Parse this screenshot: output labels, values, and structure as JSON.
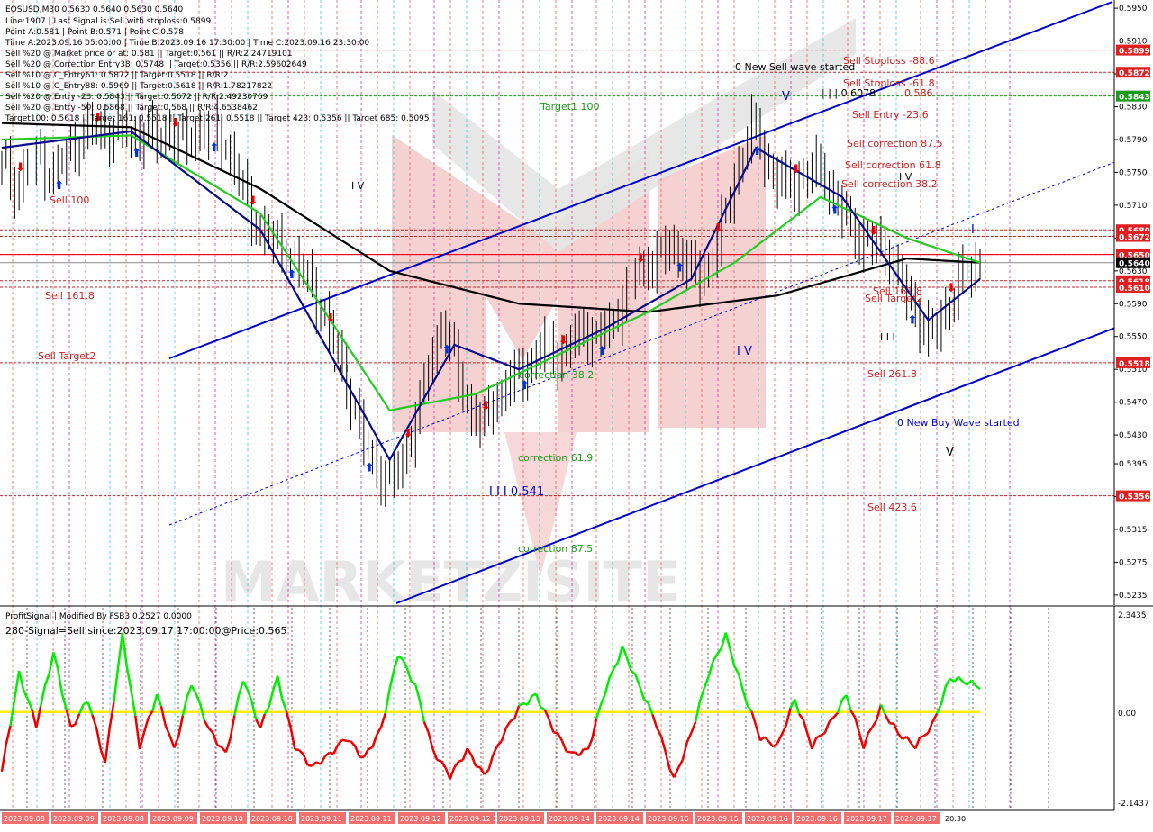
{
  "colors": {
    "background": "#ffffff",
    "candle": "#000000",
    "ma_black": "#000000",
    "ma_green": "#22cc22",
    "ma_blue": "#0a0a8c",
    "channel": "#0000cc",
    "price_line_red": "#ff0000",
    "sell_level": "#cc2222",
    "buy_level": "#1a9a1a",
    "current_level": "#000000",
    "grid_red_dash": "#e05050",
    "grid_cyan_dash": "#30c0c0",
    "grid_magenta_dash": "#c02090",
    "osc_green": "#00ee00",
    "osc_red": "#ee0000",
    "osc_zero": "#ffee00",
    "watermark": "#e6e6e6",
    "watermark_red": "#f4c6c6",
    "axis_text": "#000000"
  },
  "header": {
    "symbol_line": "EOSUSD,M30  0.5630 0.5640 0.5630 0.5640",
    "info_lines": [
      "Line:1907 | Last Signal is:Sell with stoploss:0.5899",
      "Point A:0.581 | Point B:0.571 | Point C:0.578",
      "Time A:2023.09.16 05:00:00 | Time B:2023.09.16 17:30:00 | Time C:2023.09.16 23:30:00",
      "Sell %20 @ Market price or at: 0.581 || Target:0.561 || R/R:2.24719101",
      "Sell %20 @ Correction Entry38: 0.5748 || Target:0.5356 || R/R:2.59602649",
      "Sell %10 @ C_Entry61: 0.5872 || Target:0.5518 || R/R:2",
      "Sell %10 @ C_Entry88: 0.5969 || Target:0.5618 || R/R:1.78217822",
      "Sell %20 @ Entry -23: 0.5843 || Target:0.5672 || R/R:2.49230769",
      "Sell %20 @ Entry -50: 0.5868 || Target:0.568 || R/R:4.6538462",
      "Target100: 0.5618 || Target 161: 0.5518 || Target 261: 0.5518 || Target 423: 0.5356 || Target 685: 0.5095"
    ]
  },
  "price_axis": {
    "ticks": [
      "0.5950",
      "0.5910",
      "0.5870",
      "0.5830",
      "0.5790",
      "0.5750",
      "0.5710",
      "0.5670",
      "0.5630",
      "0.5590",
      "0.5550",
      "0.5510",
      "0.5470",
      "0.5430",
      "0.5395",
      "0.5355",
      "0.5315",
      "0.5275",
      "0.5235"
    ],
    "badges": [
      {
        "value": "0.5899",
        "kind": "sell"
      },
      {
        "value": "0.5872",
        "kind": "sell"
      },
      {
        "value": "0.5843",
        "kind": "buy"
      },
      {
        "value": "0.5680",
        "kind": "sell"
      },
      {
        "value": "0.5672",
        "kind": "sell"
      },
      {
        "value": "0.5650",
        "kind": "sell"
      },
      {
        "value": "0.5640",
        "kind": "current"
      },
      {
        "value": "0.5618",
        "kind": "sell"
      },
      {
        "value": "0.5610",
        "kind": "sell"
      },
      {
        "value": "0.5518",
        "kind": "sell"
      },
      {
        "value": "0.5356",
        "kind": "sell"
      }
    ]
  },
  "annotations": {
    "sell_stoploss_886": "Sell Stoploss -88.6",
    "sell_stoploss_618": "Sell Stoploss -61.8",
    "sell_entry": "Sell Entry -23.6",
    "wave_label_top": "| | | 0.6078",
    "level_0586": "0.586",
    "sell_correction_875": "Sell correction 87.5",
    "sell_correction_618": "Sell correction 61.8",
    "sell_correction_382": "Sell correction 38.2",
    "sell_1618_right": "Sell 161.8",
    "sell_target2_right": "Sell Target2",
    "sell_2618": "Sell  261.8",
    "sell_4236": "Sell  423.6",
    "new_sell_wave": "0 New Sell wave started",
    "new_buy_wave": "0 New Buy Wave started",
    "sell_100_left": "Sell 100",
    "sell_1618_left": "Sell 161.8",
    "sell_target2_left": "Sell Target2",
    "target_100": "Target1\n100",
    "wave_0541": "I I I 0.541",
    "correction_382": "correction 38.2",
    "correction_619": "correction 61.9",
    "correction_875": "correction 87.5",
    "wave_iv_left": "I V",
    "wave_iii_left": "I I I",
    "wave_iv_mid": "I V",
    "wave_iii_right": "I I I",
    "wave_iv_right": "I V",
    "wave_v_top": "V",
    "wave_v_bottom": "V",
    "wave_i_right": "I"
  },
  "oscillator": {
    "name_line": "ProfitSignal | Modified By FSB3 0.2527 0.0000",
    "signal_line": "280-Signal=Sell since:2023.09.17 17:00:00@Price:0.565",
    "axis_ticks": [
      "2.3435",
      "0.00",
      "-2.1437"
    ]
  },
  "time_axis": {
    "labels": [
      "2023.09.08",
      "2023.09.09",
      "2023.09.08",
      "2023.09.09",
      "2023.09.10",
      "2023.09.10",
      "2023.09.11",
      "2023.09.11 02:00",
      "2023.09.12",
      "2023.09.12 15:00",
      "2023.09.13",
      "2023.09.14",
      "2023.09.14",
      "2023.09.15",
      "2023.09.15",
      "2023.09.16",
      "2023.09.16",
      "2023.09.17",
      "2023.09.17 19:00",
      "20:30"
    ]
  },
  "chart_data": {
    "type": "candlestick",
    "symbol": "EOSUSD",
    "timeframe": "M30",
    "ylim": [
      0.5225,
      0.596
    ],
    "last_price": 0.564,
    "close_path": [
      [
        0,
        0.576
      ],
      [
        3,
        0.5735
      ],
      [
        6,
        0.5752
      ],
      [
        9,
        0.5768
      ],
      [
        12,
        0.5745
      ],
      [
        15,
        0.5772
      ],
      [
        18,
        0.579
      ],
      [
        21,
        0.5805
      ],
      [
        24,
        0.5795
      ],
      [
        27,
        0.581
      ],
      [
        30,
        0.579
      ],
      [
        33,
        0.58
      ],
      [
        36,
        0.579
      ],
      [
        39,
        0.58
      ],
      [
        42,
        0.5785
      ],
      [
        45,
        0.58
      ],
      [
        48,
        0.5805
      ],
      [
        51,
        0.579
      ],
      [
        54,
        0.576
      ],
      [
        57,
        0.571
      ],
      [
        60,
        0.568
      ],
      [
        63,
        0.5665
      ],
      [
        66,
        0.565
      ],
      [
        69,
        0.5635
      ],
      [
        72,
        0.561
      ],
      [
        75,
        0.557
      ],
      [
        78,
        0.553
      ],
      [
        81,
        0.5475
      ],
      [
        84,
        0.542
      ],
      [
        87,
        0.539
      ],
      [
        90,
        0.537
      ],
      [
        93,
        0.54
      ],
      [
        96,
        0.545
      ],
      [
        99,
        0.551
      ],
      [
        102,
        0.557
      ],
      [
        105,
        0.552
      ],
      [
        108,
        0.547
      ],
      [
        111,
        0.544
      ],
      [
        114,
        0.547
      ],
      [
        117,
        0.549
      ],
      [
        120,
        0.5505
      ],
      [
        123,
        0.552
      ],
      [
        126,
        0.554
      ],
      [
        129,
        0.5525
      ],
      [
        132,
        0.554
      ],
      [
        135,
        0.556
      ],
      [
        138,
        0.5548
      ],
      [
        141,
        0.556
      ],
      [
        144,
        0.5595
      ],
      [
        147,
        0.5625
      ],
      [
        150,
        0.564
      ],
      [
        153,
        0.565
      ],
      [
        156,
        0.566
      ],
      [
        159,
        0.564
      ],
      [
        162,
        0.562
      ],
      [
        165,
        0.565
      ],
      [
        168,
        0.57
      ],
      [
        171,
        0.576
      ],
      [
        174,
        0.5808
      ],
      [
        177,
        0.577
      ],
      [
        180,
        0.574
      ],
      [
        183,
        0.5735
      ],
      [
        186,
        0.5745
      ],
      [
        189,
        0.5755
      ],
      [
        192,
        0.5735
      ],
      [
        195,
        0.57
      ],
      [
        198,
        0.5675
      ],
      [
        201,
        0.5665
      ],
      [
        204,
        0.566
      ],
      [
        207,
        0.564
      ],
      [
        210,
        0.56
      ],
      [
        213,
        0.557
      ],
      [
        216,
        0.555
      ],
      [
        219,
        0.558
      ],
      [
        222,
        0.562
      ],
      [
        225,
        0.563
      ],
      [
        227,
        0.564
      ]
    ],
    "moving_averages": [
      {
        "name": "slow",
        "color": "#000000",
        "points": [
          [
            0,
            0.581
          ],
          [
            30,
            0.5805
          ],
          [
            60,
            0.573
          ],
          [
            90,
            0.563
          ],
          [
            120,
            0.559
          ],
          [
            150,
            0.558
          ],
          [
            180,
            0.56
          ],
          [
            210,
            0.5645
          ],
          [
            227,
            0.564
          ]
        ]
      },
      {
        "name": "medium",
        "color": "#22cc22",
        "points": [
          [
            0,
            0.579
          ],
          [
            30,
            0.5795
          ],
          [
            60,
            0.57
          ],
          [
            90,
            0.546
          ],
          [
            110,
            0.548
          ],
          [
            130,
            0.553
          ],
          [
            150,
            0.558
          ],
          [
            170,
            0.564
          ],
          [
            190,
            0.572
          ],
          [
            210,
            0.567
          ],
          [
            227,
            0.564
          ]
        ]
      },
      {
        "name": "fast",
        "color": "#0a0a8c",
        "points": [
          [
            0,
            0.578
          ],
          [
            30,
            0.58
          ],
          [
            60,
            0.568
          ],
          [
            90,
            0.54
          ],
          [
            105,
            0.554
          ],
          [
            120,
            0.551
          ],
          [
            140,
            0.556
          ],
          [
            160,
            0.562
          ],
          [
            175,
            0.578
          ],
          [
            195,
            0.572
          ],
          [
            215,
            0.557
          ],
          [
            227,
            0.562
          ]
        ]
      }
    ],
    "oscillator_ylim": [
      -2.1437,
      2.3435
    ],
    "oscillator_points": [
      [
        0,
        -1.4
      ],
      [
        4,
        0.9
      ],
      [
        8,
        -0.3
      ],
      [
        12,
        1.4
      ],
      [
        16,
        -0.4
      ],
      [
        20,
        0.3
      ],
      [
        24,
        -1.2
      ],
      [
        28,
        1.8
      ],
      [
        32,
        -0.8
      ],
      [
        36,
        0.4
      ],
      [
        40,
        -0.9
      ],
      [
        44,
        0.7
      ],
      [
        48,
        -0.4
      ],
      [
        52,
        -1.0
      ],
      [
        56,
        0.8
      ],
      [
        60,
        -0.4
      ],
      [
        64,
        0.8
      ],
      [
        68,
        -0.8
      ],
      [
        72,
        -1.3
      ],
      [
        76,
        -1.0
      ],
      [
        80,
        -0.6
      ],
      [
        84,
        -1.1
      ],
      [
        88,
        -0.4
      ],
      [
        92,
        1.4
      ],
      [
        96,
        0.6
      ],
      [
        100,
        -0.9
      ],
      [
        104,
        -1.5
      ],
      [
        108,
        -0.9
      ],
      [
        112,
        -1.5
      ],
      [
        116,
        -0.6
      ],
      [
        120,
        0.1
      ],
      [
        124,
        0.4
      ],
      [
        128,
        -0.4
      ],
      [
        132,
        -1.0
      ],
      [
        136,
        -0.9
      ],
      [
        140,
        0.5
      ],
      [
        144,
        1.5
      ],
      [
        148,
        0.6
      ],
      [
        152,
        -0.3
      ],
      [
        156,
        -1.6
      ],
      [
        160,
        -0.5
      ],
      [
        164,
        0.9
      ],
      [
        168,
        1.8
      ],
      [
        172,
        0.5
      ],
      [
        176,
        -0.6
      ],
      [
        180,
        -0.8
      ],
      [
        184,
        0.3
      ],
      [
        188,
        -0.8
      ],
      [
        192,
        -0.3
      ],
      [
        196,
        0.4
      ],
      [
        200,
        -0.8
      ],
      [
        204,
        0.1
      ],
      [
        208,
        -0.5
      ],
      [
        212,
        -0.8
      ],
      [
        216,
        -0.3
      ],
      [
        220,
        0.8
      ],
      [
        224,
        0.7
      ],
      [
        227,
        0.6
      ]
    ]
  }
}
